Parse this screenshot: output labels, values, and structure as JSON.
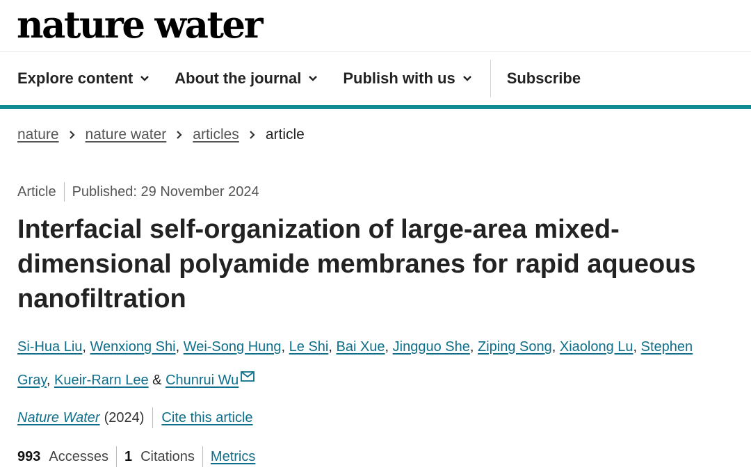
{
  "logo": {
    "text": "nature water"
  },
  "nav": {
    "items": [
      {
        "label": "Explore content"
      },
      {
        "label": "About the journal"
      },
      {
        "label": "Publish with us"
      },
      {
        "label": "Subscribe"
      }
    ]
  },
  "breadcrumb": {
    "items": [
      "nature",
      "nature water",
      "articles"
    ],
    "current": "article"
  },
  "meta": {
    "type": "Article",
    "published": "Published: 29 November 2024"
  },
  "article": {
    "title": "Interfacial self-organization of large-area mixed-dimensional polyamide membranes for rapid aqueous nanofiltration"
  },
  "authors": [
    "Si-Hua Liu",
    "Wenxiong Shi",
    "Wei-Song Hung",
    "Le Shi",
    "Bai Xue",
    "Jingguo She",
    "Ziping Song",
    "Xiaolong Lu",
    "Stephen Gray",
    "Kueir-Rarn Lee",
    "Chunrui Wu"
  ],
  "authors_sep": ", ",
  "authors_last_sep": " & ",
  "journal": {
    "name": "Nature Water",
    "year": "(2024)",
    "cite_label": "Cite this article"
  },
  "metrics": {
    "accesses_value": "993",
    "accesses_label": "Accesses",
    "citations_value": "1",
    "citations_label": "Citations",
    "metrics_link": "Metrics"
  },
  "colors": {
    "accent": "#0e8a93",
    "link": "#0f6e8a"
  },
  "icons": {
    "nav_dropdown": "chevron-down-icon",
    "breadcrumb_sep": "chevron-right-icon",
    "corresponding": "mail-icon"
  }
}
